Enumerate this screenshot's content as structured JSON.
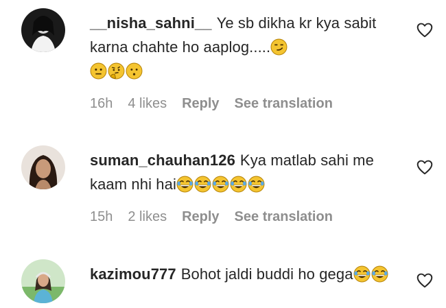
{
  "comments": [
    {
      "username": "__nisha_sahni__",
      "text": "Ye sb dikha kr kya sabit karna chahte ho aaplog.....",
      "emojis_inline": [
        "smirk-face"
      ],
      "emojis_line": [
        "neutral-face",
        "thinking-face",
        "surprised-face"
      ],
      "time": "16h",
      "likes": "4 likes",
      "reply": "Reply",
      "translate": "See translation"
    },
    {
      "username": "suman_chauhan126",
      "text": "Kya matlab sahi me kaam nhi hai",
      "emojis_inline": [
        "laughing-tears-face",
        "laughing-tears-face",
        "laughing-tears-face",
        "laughing-tears-face",
        "laughing-tears-face"
      ],
      "time": "15h",
      "likes": "2 likes",
      "reply": "Reply",
      "translate": "See translation"
    },
    {
      "username": "kazimou777",
      "text": "Bohot jaldi buddi ho gega",
      "emojis_inline": [
        "laughing-tears-face",
        "laughing-tears-face"
      ]
    }
  ],
  "colors": {
    "text": "#262626",
    "muted": "#8e8e8e",
    "emoji": "#f4c430"
  }
}
